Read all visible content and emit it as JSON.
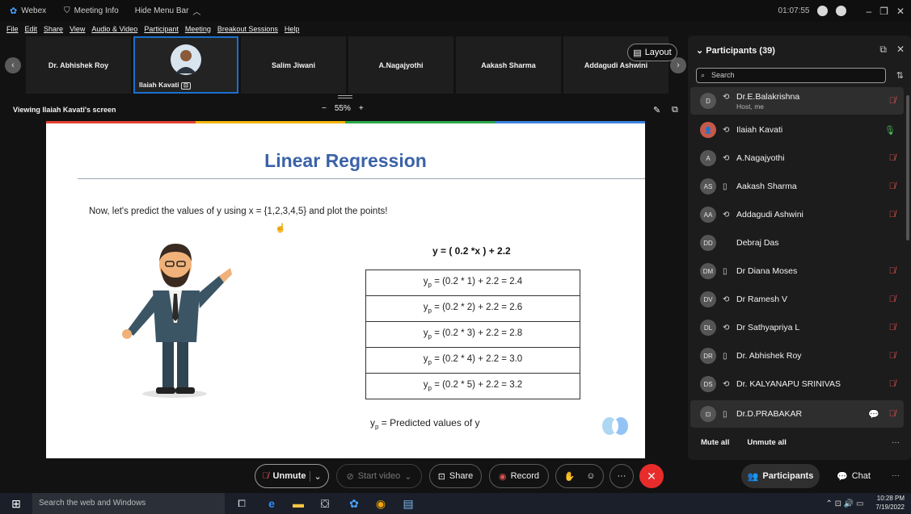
{
  "titlebar": {
    "app_name": "Webex",
    "meeting_info": "Meeting Info",
    "hide_menu": "Hide Menu Bar",
    "timer": "01:07:55",
    "minimize": "–",
    "maximize": "❐",
    "close": "✕"
  },
  "menu": [
    "File",
    "Edit",
    "Share",
    "View",
    "Audio & Video",
    "Participant",
    "Meeting",
    "Breakout Sessions",
    "Help"
  ],
  "strip": {
    "tiles": [
      "Dr. Abhishek Roy",
      "",
      "Salim Jiwani",
      "A.Nagajyothi",
      "Aakash Sharma",
      "Addagudi Ashwini"
    ],
    "active_name": "Ilaiah Kavati",
    "layout_label": "Layout"
  },
  "viewbar": {
    "label": "Viewing Ilaiah Kavati's screen",
    "zoom_minus": "−",
    "zoom_value": "55%",
    "zoom_plus": "+"
  },
  "slide": {
    "title": "Linear Regression",
    "text": "Now, let's predict the values of y using x = {1,2,3,4,5} and plot the points!",
    "formula": "y = ( 0.2 *x ) + 2.2",
    "rows": [
      {
        "lhs": "y",
        "sub": "p",
        "rhs": " = (0.2 * 1) + 2.2 = 2.4"
      },
      {
        "lhs": "y",
        "sub": "p",
        "rhs": " = (0.2 * 2) + 2.2 = 2.6"
      },
      {
        "lhs": "y",
        "sub": "p",
        "rhs": " = (0.2 * 3) + 2.2 = 2.8"
      },
      {
        "lhs": "y",
        "sub": "p",
        "rhs": " = (0.2 * 4) + 2.2 = 3.0"
      },
      {
        "lhs": "y",
        "sub": "p",
        "rhs": " = (0.2 * 5) + 2.2 = 3.2"
      }
    ],
    "note_lhs": "y",
    "note_sub": "p",
    "note_rhs": " = Predicted values of y"
  },
  "panel": {
    "title": "Participants (39)",
    "search_placeholder": "Search",
    "participants": [
      {
        "initials": "D",
        "name": "Dr.E.Balakrishna",
        "sub": "Host, me",
        "device": "⟲",
        "muted": true
      },
      {
        "initials": "",
        "name": "Ilaiah Kavati",
        "sub": "",
        "device": "⟲",
        "muted": false
      },
      {
        "initials": "A",
        "name": "A.Nagajyothi",
        "sub": "",
        "device": "⟲",
        "muted": true
      },
      {
        "initials": "AS",
        "name": "Aakash Sharma",
        "sub": "",
        "device": "▯",
        "muted": true
      },
      {
        "initials": "AA",
        "name": "Addagudi Ashwini",
        "sub": "",
        "device": "⟲",
        "muted": true
      },
      {
        "initials": "DD",
        "name": "Debraj Das",
        "sub": "",
        "device": "",
        "muted": false
      },
      {
        "initials": "DM",
        "name": "Dr Diana Moses",
        "sub": "",
        "device": "▯",
        "muted": true
      },
      {
        "initials": "DV",
        "name": "Dr Ramesh V",
        "sub": "",
        "device": "⟲",
        "muted": true
      },
      {
        "initials": "DL",
        "name": "Dr Sathyapriya L",
        "sub": "",
        "device": "⟲",
        "muted": true
      },
      {
        "initials": "DR",
        "name": "Dr. Abhishek Roy",
        "sub": "",
        "device": "▯",
        "muted": true
      },
      {
        "initials": "DS",
        "name": "Dr. KALYANAPU SRINIVAS",
        "sub": "",
        "device": "⟲",
        "muted": true
      },
      {
        "initials": "",
        "name": "Dr.D.PRABAKAR",
        "sub": "",
        "device": "▯",
        "muted": true
      }
    ],
    "mute_all": "Mute all",
    "unmute_all": "Unmute all"
  },
  "controls": {
    "unmute": "Unmute",
    "start_video": "Start video",
    "share": "Share",
    "record": "Record",
    "participants": "Participants",
    "chat": "Chat"
  },
  "taskbar": {
    "search": "Search the web and Windows",
    "time": "10:28 PM",
    "date": "7/19/2022"
  },
  "colors": {
    "accent": "#1c6fd1",
    "mute_red": "#e05252",
    "end_red": "#e82c2c",
    "slide_title": "#3a62a8"
  }
}
